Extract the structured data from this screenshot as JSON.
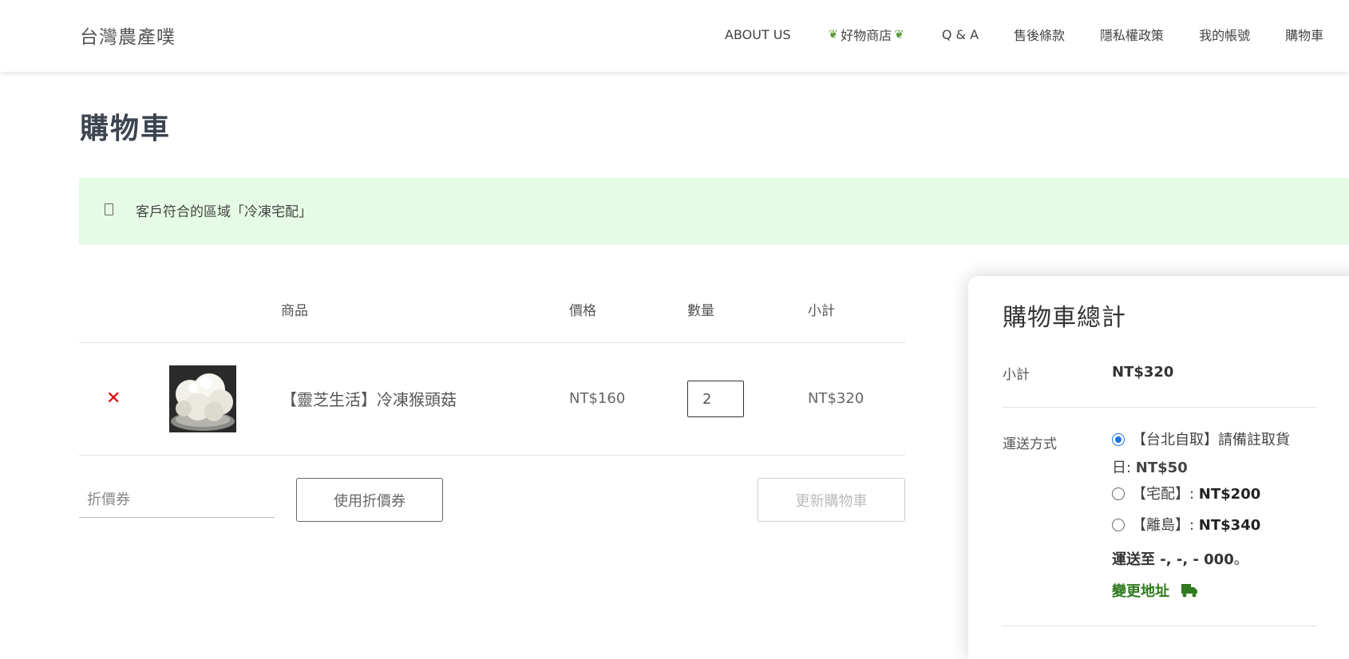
{
  "header": {
    "logo": "台灣農產噗",
    "nav": [
      "ABOUT US",
      "好物商店",
      "Q & A",
      "售後條款",
      "隱私權政策",
      "我的帳號",
      "購物車"
    ],
    "leaf_icon": "leaf-icon"
  },
  "page": {
    "title": "購物車"
  },
  "notice": {
    "icon": "info-square-icon",
    "text": "客戶符合的區域「冷凍宅配」"
  },
  "cart": {
    "headers": {
      "product": "商品",
      "price": "價格",
      "quantity": "數量",
      "subtotal": "小計"
    },
    "items": [
      {
        "name": "【靈芝生活】冷凍猴頭菇",
        "price": "NT$160",
        "quantity": "2",
        "subtotal": "NT$320",
        "remove_icon": "close-icon"
      }
    ],
    "coupon_placeholder": "折價券",
    "apply_coupon": "使用折價券",
    "update_cart": "更新購物車"
  },
  "totals": {
    "title": "購物車總計",
    "subtotal_label": "小計",
    "subtotal_value": "NT$320",
    "shipping_label": "運送方式",
    "options": [
      {
        "line1": "【台北自取】請備註取貨",
        "line2_prefix": "日: ",
        "price": "NT$50",
        "selected": true
      },
      {
        "label": "【宅配】: ",
        "price": "NT$200",
        "selected": false
      },
      {
        "label": "【離島】: ",
        "price": "NT$340",
        "selected": false
      }
    ],
    "ship_to_prefix": "運送至",
    "ship_to_address": " -, -, - 000",
    "ship_to_suffix": "。",
    "change_address": "變更地址",
    "accent_color": "#2f7a1f",
    "radio_color": "#1a73e8"
  }
}
